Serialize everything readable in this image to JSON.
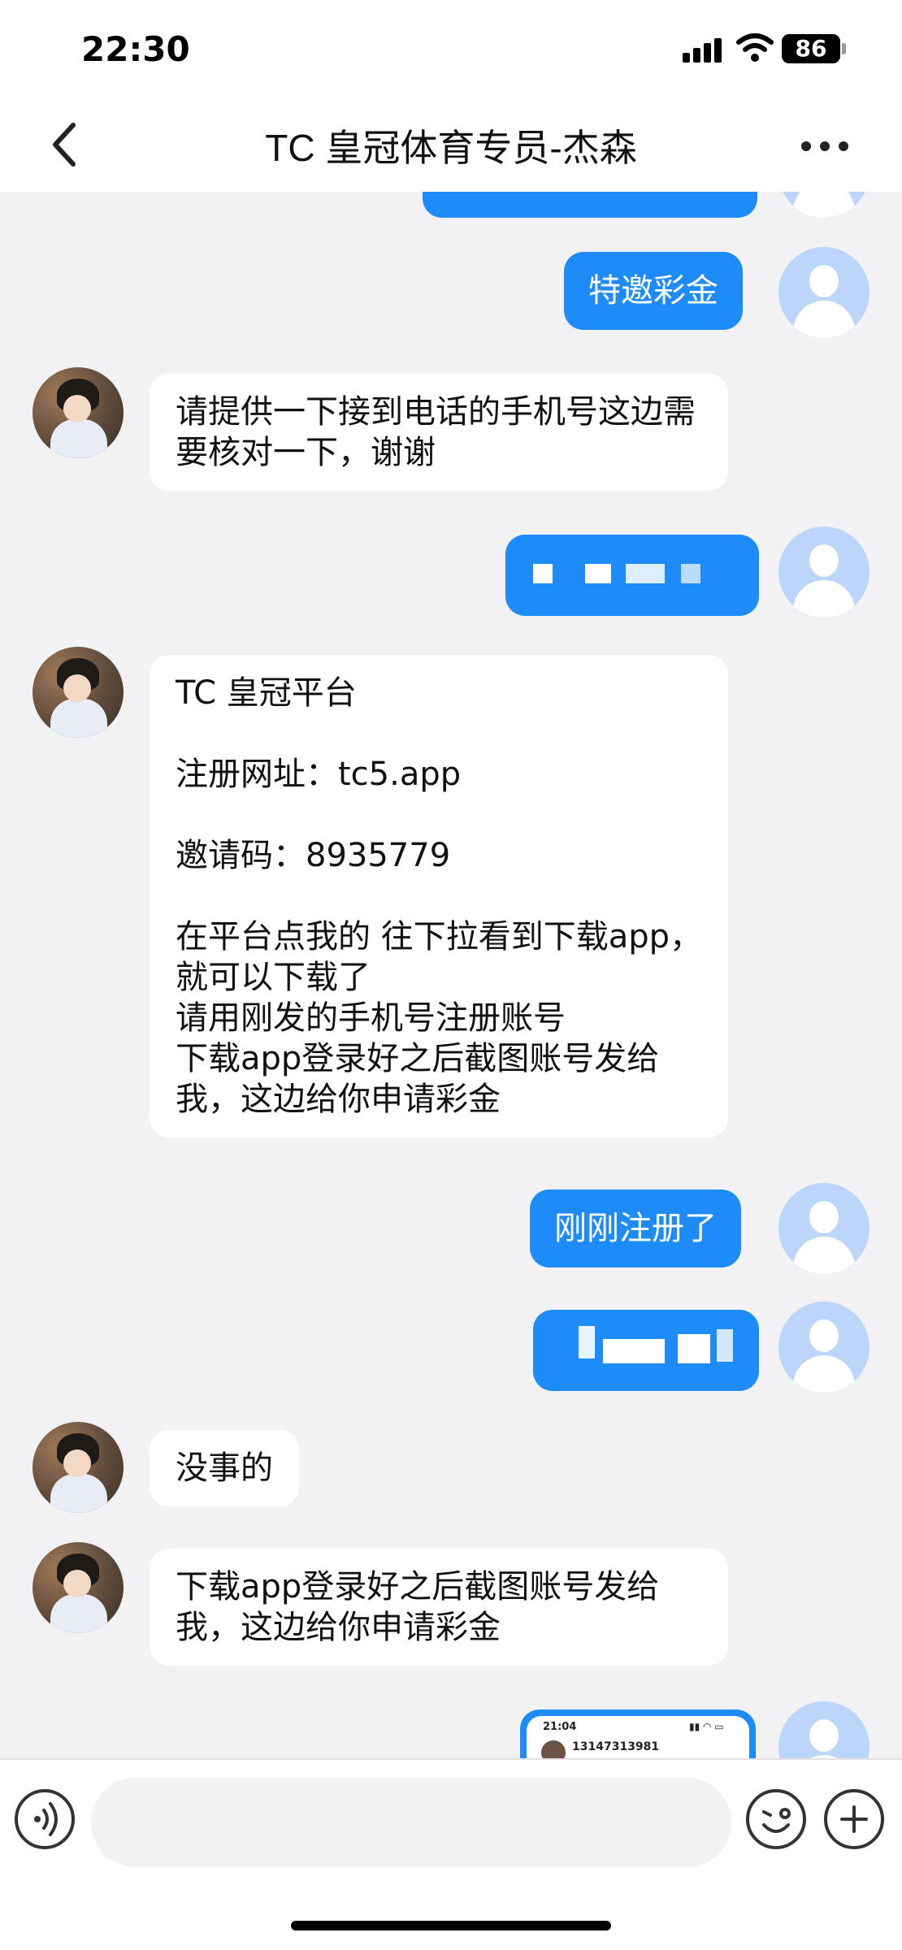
{
  "status_bar": {
    "time": "22:30",
    "battery": "86"
  },
  "header": {
    "title": "TC 皇冠体育专员-杰森"
  },
  "messages": [
    {
      "from": "self",
      "text": "特邀彩金"
    },
    {
      "from": "other",
      "text": "请提供一下接到电话的手机号这边需要核对一下，谢谢"
    },
    {
      "from": "self",
      "text": "",
      "note": "pixelated"
    },
    {
      "from": "other",
      "text": "TC 皇冠平台\n\n注册网址：tc5.app\n\n邀请码：8935779\n\n在平台点我的 往下拉看到下载app，就可以下载了\n请用刚发的手机号注册账号\n下载app登录好之后截图账号发给我，这边给你申请彩金"
    },
    {
      "from": "self",
      "text": "刚刚注册了"
    },
    {
      "from": "self",
      "text": "",
      "note": "pixelated"
    },
    {
      "from": "other",
      "text": "没事的"
    },
    {
      "from": "other",
      "text": "下载app登录好之后截图账号发给我，这边给你申请彩金"
    }
  ],
  "screenshot_thumb": {
    "time": "21:04",
    "phone": "13147313981"
  },
  "input": {
    "placeholder": ""
  },
  "colors": {
    "bubble_out": "#1d8cf8",
    "bubble_in": "#ffffff",
    "bg": "#f2f2f5"
  },
  "icons": {
    "back": "chevron-left-icon",
    "more": "ellipsis-icon",
    "voice": "voice-icon",
    "emoji": "emoji-icon",
    "plus": "plus-icon"
  }
}
